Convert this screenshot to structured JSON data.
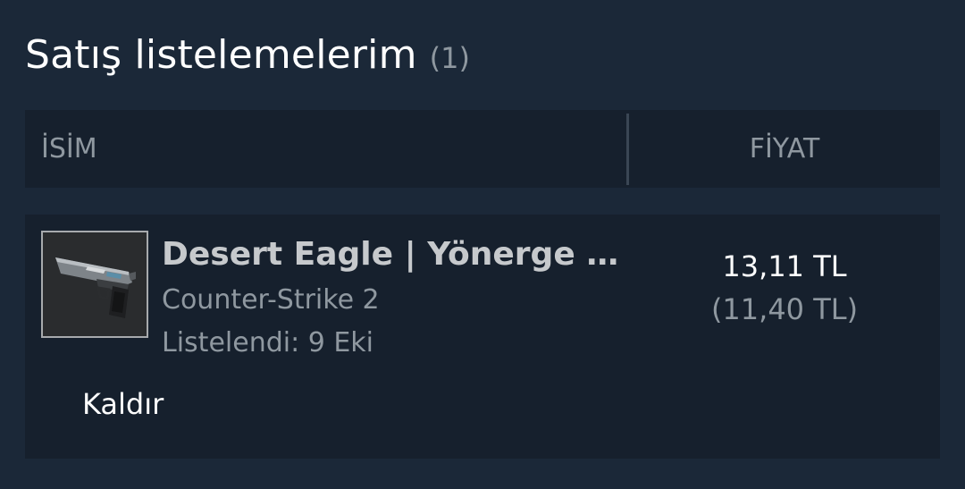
{
  "section": {
    "title": "Satış listelemelerim",
    "count": "(1)"
  },
  "table": {
    "columns": {
      "name": "İSİM",
      "price": "FİYAT"
    }
  },
  "listing": {
    "item_name": "Desert Eagle | Yönerge (…",
    "game": "Counter-Strike 2",
    "listed": "Listelendi: 9 Eki",
    "price": "13,11 TL",
    "price_net": "(11,40 TL)",
    "remove_label": "Kaldır",
    "thumbnail_icon": "desert-eagle-pistol-icon"
  },
  "colors": {
    "background": "#1b2838",
    "row_background": "#16202d",
    "muted_text": "#8f98a0"
  }
}
